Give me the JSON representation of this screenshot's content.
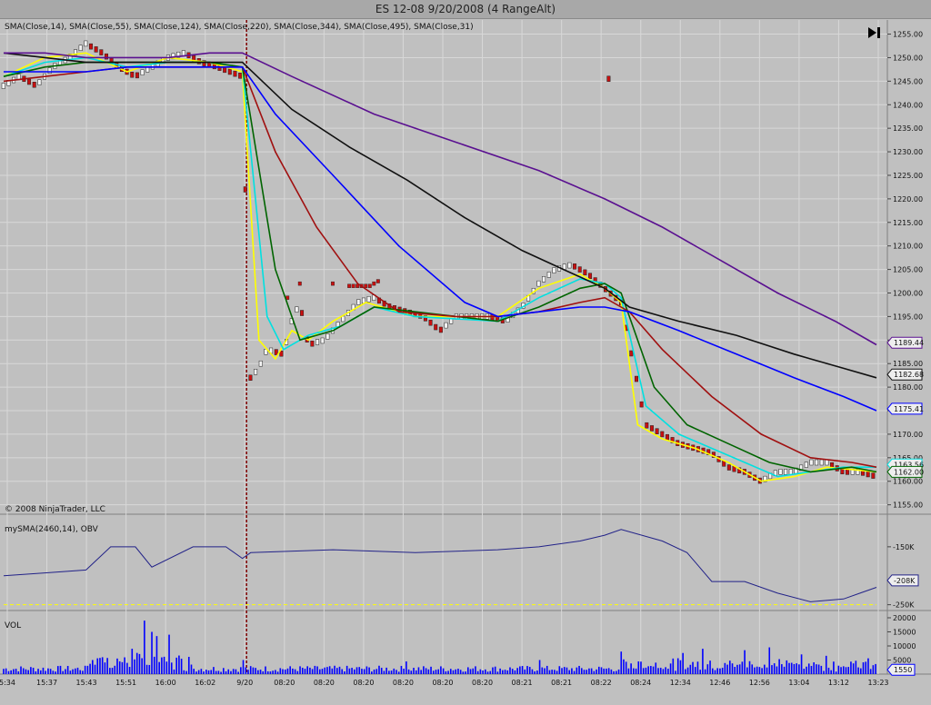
{
  "window": {
    "title": "ES 12-08  9/20/2008 (4 RangeAlt)"
  },
  "indicators_label": "SMA(Close,14), SMA(Close,55), SMA(Close,124), SMA(Close,220), SMA(Close,344), SMA(Close,495), SMA(Close,31)",
  "copyright": "© 2008 NinjaTrader, LLC",
  "obv_label": "mySMA(2460,14), OBV",
  "vol_label": "VOL",
  "go_to_last_bar_icon": "skip-to-end-icon",
  "colors": {
    "background": "#c0c0c0",
    "grid": "#d8d8d8",
    "price_up": "#f4f4f4",
    "price_down": "#c81010",
    "sma14": "#ffff00",
    "sma31": "#00e0e0",
    "sma55": "#006400",
    "sma124": "#a01010",
    "sma220": "#0000ff",
    "sma344": "#101010",
    "sma495": "#5a1090",
    "obv": "#222288",
    "volume": "#0000ff",
    "session_line": "#800000"
  },
  "chart_data": [
    {
      "type": "line",
      "name": "price",
      "ylim": [
        1153,
        1258
      ],
      "yticks": [
        "1155.00",
        "1160.00",
        "1165.00",
        "1170.00",
        "1175.00",
        "1180.00",
        "1185.00",
        "1190.00",
        "1195.00",
        "1200.00",
        "1205.00",
        "1210.00",
        "1215.00",
        "1220.00",
        "1225.00",
        "1230.00",
        "1235.00",
        "1240.00",
        "1245.00",
        "1250.00",
        "1255.00"
      ],
      "price_markers": [
        "1189.44",
        "1182.68",
        "1175.41",
        "1163.56",
        "1162.00"
      ],
      "x_labels": [
        "5:34",
        "15:37",
        "15:43",
        "15:51",
        "16:00",
        "16:02",
        "9/20",
        "08:20",
        "08:20",
        "08:20",
        "08:20",
        "08:20",
        "08:20",
        "08:21",
        "08:21",
        "08:22",
        "08:24",
        "12:34",
        "12:46",
        "12:56",
        "13:04",
        "13:12",
        "13:23"
      ],
      "price_path": [
        [
          0,
          1244
        ],
        [
          4,
          1246
        ],
        [
          8,
          1244
        ],
        [
          12,
          1248
        ],
        [
          16,
          1250
        ],
        [
          20,
          1253
        ],
        [
          24,
          1251
        ],
        [
          28,
          1248
        ],
        [
          32,
          1246
        ],
        [
          36,
          1248
        ],
        [
          40,
          1250
        ],
        [
          44,
          1251
        ],
        [
          48,
          1249
        ],
        [
          52,
          1248
        ],
        [
          58,
          1246
        ],
        [
          60,
          1182
        ],
        [
          62,
          1184
        ],
        [
          64,
          1188
        ],
        [
          68,
          1187
        ],
        [
          70,
          1194
        ],
        [
          72,
          1198
        ],
        [
          74,
          1189
        ],
        [
          78,
          1190
        ],
        [
          82,
          1194
        ],
        [
          86,
          1198
        ],
        [
          90,
          1199
        ],
        [
          94,
          1197
        ],
        [
          98,
          1196
        ],
        [
          102,
          1195
        ],
        [
          106,
          1192
        ],
        [
          110,
          1195
        ],
        [
          114,
          1195
        ],
        [
          118,
          1195
        ],
        [
          122,
          1194
        ],
        [
          126,
          1197
        ],
        [
          130,
          1202
        ],
        [
          134,
          1205
        ],
        [
          138,
          1206
        ],
        [
          142,
          1204
        ],
        [
          146,
          1201
        ],
        [
          150,
          1198
        ],
        [
          156,
          1172
        ],
        [
          160,
          1170
        ],
        [
          164,
          1168
        ],
        [
          168,
          1167
        ],
        [
          172,
          1166
        ],
        [
          176,
          1163
        ],
        [
          180,
          1162
        ],
        [
          184,
          1160
        ],
        [
          188,
          1162
        ],
        [
          192,
          1162
        ],
        [
          196,
          1164
        ],
        [
          200,
          1164
        ],
        [
          204,
          1162
        ],
        [
          208,
          1162
        ],
        [
          212,
          1161
        ]
      ],
      "series": [
        {
          "name": "SMA(Close,14)",
          "values": [
            [
              0,
              1246
            ],
            [
              10,
              1250
            ],
            [
              20,
              1251
            ],
            [
              30,
              1247
            ],
            [
              40,
              1250
            ],
            [
              50,
              1249
            ],
            [
              58,
              1247
            ],
            [
              62,
              1190
            ],
            [
              66,
              1186
            ],
            [
              70,
              1192
            ],
            [
              74,
              1190
            ],
            [
              80,
              1194
            ],
            [
              88,
              1198
            ],
            [
              100,
              1195
            ],
            [
              120,
              1195
            ],
            [
              130,
              1201
            ],
            [
              140,
              1204
            ],
            [
              146,
              1201
            ],
            [
              150,
              1198
            ],
            [
              154,
              1172
            ],
            [
              160,
              1169
            ],
            [
              168,
              1167
            ],
            [
              176,
              1164
            ],
            [
              184,
              1160
            ],
            [
              192,
              1161
            ],
            [
              200,
              1163
            ],
            [
              212,
              1162
            ]
          ]
        },
        {
          "name": "SMA(Close,31)",
          "values": [
            [
              0,
              1246
            ],
            [
              10,
              1249
            ],
            [
              20,
              1250
            ],
            [
              30,
              1248
            ],
            [
              40,
              1249
            ],
            [
              50,
              1249
            ],
            [
              58,
              1248
            ],
            [
              64,
              1195
            ],
            [
              68,
              1188
            ],
            [
              74,
              1191
            ],
            [
              82,
              1193
            ],
            [
              90,
              1197
            ],
            [
              100,
              1195
            ],
            [
              120,
              1194
            ],
            [
              130,
              1199
            ],
            [
              140,
              1203
            ],
            [
              146,
              1202
            ],
            [
              150,
              1199
            ],
            [
              156,
              1176
            ],
            [
              164,
              1170
            ],
            [
              172,
              1167
            ],
            [
              180,
              1164
            ],
            [
              188,
              1161
            ],
            [
              196,
              1162
            ],
            [
              204,
              1163
            ],
            [
              212,
              1163
            ]
          ]
        },
        {
          "name": "SMA(Close,55)",
          "values": [
            [
              0,
              1246
            ],
            [
              10,
              1248
            ],
            [
              20,
              1249
            ],
            [
              30,
              1249
            ],
            [
              40,
              1249
            ],
            [
              50,
              1249
            ],
            [
              58,
              1248
            ],
            [
              66,
              1205
            ],
            [
              72,
              1190
            ],
            [
              80,
              1192
            ],
            [
              90,
              1197
            ],
            [
              100,
              1196
            ],
            [
              120,
              1194
            ],
            [
              130,
              1197
            ],
            [
              140,
              1201
            ],
            [
              146,
              1202
            ],
            [
              150,
              1200
            ],
            [
              158,
              1180
            ],
            [
              166,
              1172
            ],
            [
              176,
              1168
            ],
            [
              186,
              1164
            ],
            [
              196,
              1162
            ],
            [
              206,
              1163
            ],
            [
              212,
              1162
            ]
          ]
        },
        {
          "name": "SMA(Close,124)",
          "values": [
            [
              0,
              1245
            ],
            [
              10,
              1246
            ],
            [
              20,
              1247
            ],
            [
              30,
              1248
            ],
            [
              40,
              1248
            ],
            [
              50,
              1248
            ],
            [
              58,
              1248
            ],
            [
              66,
              1230
            ],
            [
              76,
              1214
            ],
            [
              86,
              1202
            ],
            [
              96,
              1196
            ],
            [
              110,
              1195
            ],
            [
              120,
              1195
            ],
            [
              130,
              1196
            ],
            [
              140,
              1198
            ],
            [
              146,
              1199
            ],
            [
              152,
              1196
            ],
            [
              160,
              1188
            ],
            [
              172,
              1178
            ],
            [
              184,
              1170
            ],
            [
              196,
              1165
            ],
            [
              206,
              1164
            ],
            [
              212,
              1163
            ]
          ]
        },
        {
          "name": "SMA(Close,220)",
          "values": [
            [
              0,
              1247
            ],
            [
              10,
              1247
            ],
            [
              20,
              1247
            ],
            [
              30,
              1248
            ],
            [
              40,
              1248
            ],
            [
              50,
              1248
            ],
            [
              58,
              1248
            ],
            [
              66,
              1238
            ],
            [
              80,
              1225
            ],
            [
              96,
              1210
            ],
            [
              112,
              1198
            ],
            [
              120,
              1195
            ],
            [
              130,
              1196
            ],
            [
              140,
              1197
            ],
            [
              146,
              1197
            ],
            [
              152,
              1196
            ],
            [
              164,
              1192
            ],
            [
              178,
              1187
            ],
            [
              192,
              1182
            ],
            [
              204,
              1178
            ],
            [
              212,
              1175
            ]
          ]
        },
        {
          "name": "SMA(Close,344)",
          "values": [
            [
              0,
              1251
            ],
            [
              10,
              1250
            ],
            [
              20,
              1249
            ],
            [
              30,
              1249
            ],
            [
              40,
              1249
            ],
            [
              50,
              1249
            ],
            [
              58,
              1249
            ],
            [
              70,
              1239
            ],
            [
              84,
              1231
            ],
            [
              98,
              1224
            ],
            [
              112,
              1216
            ],
            [
              126,
              1209
            ],
            [
              136,
              1205
            ],
            [
              146,
              1201
            ],
            [
              152,
              1197
            ],
            [
              164,
              1194
            ],
            [
              178,
              1191
            ],
            [
              192,
              1187
            ],
            [
              204,
              1184
            ],
            [
              212,
              1182
            ]
          ]
        },
        {
          "name": "SMA(Close,495)",
          "values": [
            [
              0,
              1251
            ],
            [
              10,
              1251
            ],
            [
              20,
              1250
            ],
            [
              30,
              1250
            ],
            [
              40,
              1250
            ],
            [
              50,
              1251
            ],
            [
              58,
              1251
            ],
            [
              70,
              1246
            ],
            [
              90,
              1238
            ],
            [
              110,
              1232
            ],
            [
              130,
              1226
            ],
            [
              146,
              1220
            ],
            [
              160,
              1214
            ],
            [
              174,
              1207
            ],
            [
              188,
              1200
            ],
            [
              202,
              1194
            ],
            [
              212,
              1189
            ]
          ]
        }
      ]
    },
    {
      "type": "line",
      "name": "OBV",
      "ylim": [
        -260,
        -100
      ],
      "yticks": [
        "-150K",
        "-208K",
        "-250K"
      ],
      "obv_marker": "-208K",
      "series": [
        {
          "name": "mySMA(2460,14)",
          "values": [
            [
              0,
              -250
            ],
            [
              212,
              -250
            ]
          ]
        },
        {
          "name": "OBV",
          "values": [
            [
              0,
              -200
            ],
            [
              10,
              -195
            ],
            [
              20,
              -190
            ],
            [
              26,
              -150
            ],
            [
              32,
              -150
            ],
            [
              36,
              -185
            ],
            [
              46,
              -150
            ],
            [
              54,
              -150
            ],
            [
              58,
              -170
            ],
            [
              60,
              -160
            ],
            [
              80,
              -155
            ],
            [
              100,
              -160
            ],
            [
              120,
              -155
            ],
            [
              130,
              -150
            ],
            [
              140,
              -140
            ],
            [
              146,
              -130
            ],
            [
              150,
              -120
            ],
            [
              160,
              -140
            ],
            [
              166,
              -160
            ],
            [
              172,
              -210
            ],
            [
              180,
              -210
            ],
            [
              188,
              -230
            ],
            [
              196,
              -245
            ],
            [
              204,
              -240
            ],
            [
              208,
              -230
            ],
            [
              212,
              -220
            ]
          ]
        }
      ]
    },
    {
      "type": "bar",
      "name": "VOL",
      "ylim": [
        0,
        20000
      ],
      "yticks": [
        "20000",
        "15000",
        "10000",
        "5000"
      ],
      "vol_marker": "1550"
    }
  ]
}
